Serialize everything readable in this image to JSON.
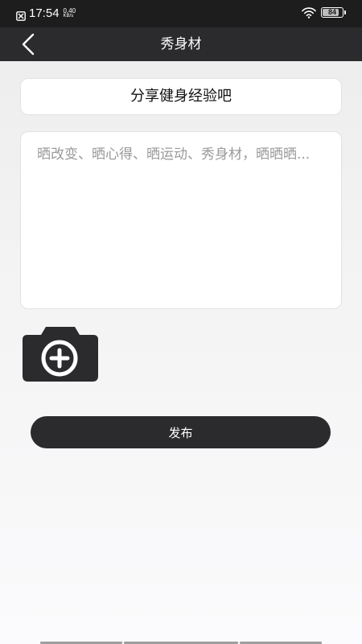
{
  "status_bar": {
    "time": "17:54",
    "net_speed_value": "0.40",
    "net_speed_unit": "KB/s",
    "battery_level": "84",
    "battery_fraction": 0.84,
    "icons": [
      "notification-blocked-icon",
      "wifi-icon",
      "battery-icon"
    ]
  },
  "nav": {
    "title": "秀身材",
    "back_icon": "chevron-left-icon"
  },
  "topic": {
    "label": "分享健身经验吧"
  },
  "content": {
    "placeholder": "晒改变、晒心得、晒运动、秀身材，晒晒晒...",
    "value": ""
  },
  "media": {
    "add_photo_icon": "camera-plus-icon"
  },
  "actions": {
    "publish_label": "发布"
  },
  "colors": {
    "primary_dark": "#2b2a2d",
    "status_bar": "#1d1d1d",
    "card_bg": "#ffffff",
    "placeholder": "#9a9a9a"
  }
}
